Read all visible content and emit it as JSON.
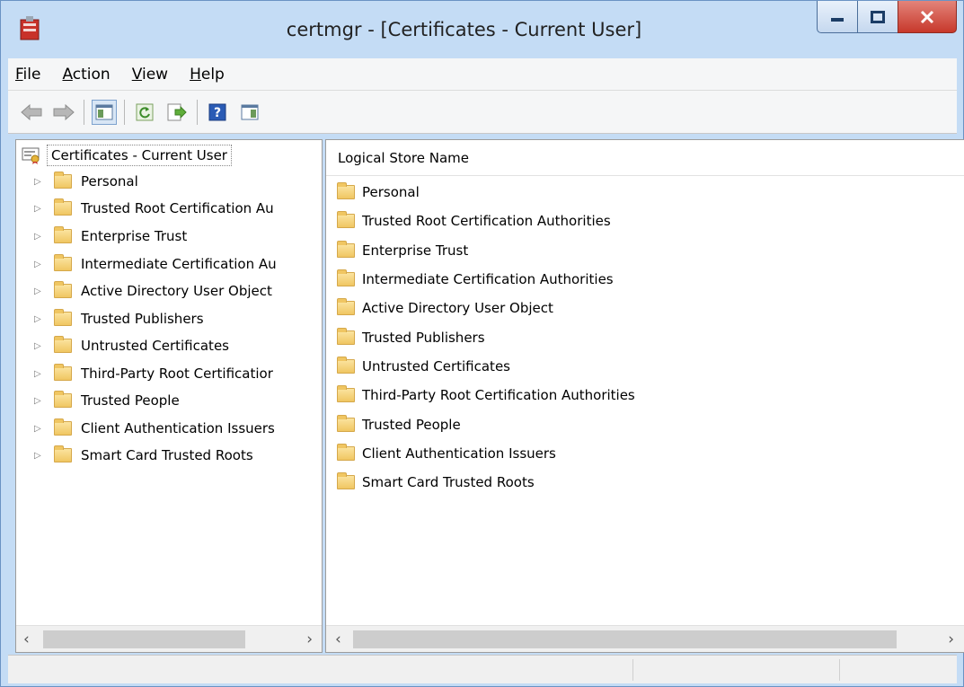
{
  "window": {
    "title": "certmgr - [Certificates - Current User]"
  },
  "menu": [
    {
      "label": "File",
      "accel": "F",
      "rest": "ile"
    },
    {
      "label": "Action",
      "accel": "A",
      "rest": "ction"
    },
    {
      "label": "View",
      "accel": "V",
      "rest": "iew"
    },
    {
      "label": "Help",
      "accel": "H",
      "rest": "elp"
    }
  ],
  "tree": {
    "root": "Certificates - Current User",
    "items": [
      "Personal",
      "Trusted Root Certification Au",
      "Enterprise Trust",
      "Intermediate Certification Au",
      "Active Directory User Object",
      "Trusted Publishers",
      "Untrusted Certificates",
      "Third-Party Root Certificatior",
      "Trusted People",
      "Client Authentication Issuers",
      "Smart Card Trusted Roots"
    ]
  },
  "list": {
    "column_header": "Logical Store Name",
    "items": [
      "Personal",
      "Trusted Root Certification Authorities",
      "Enterprise Trust",
      "Intermediate Certification Authorities",
      "Active Directory User Object",
      "Trusted Publishers",
      "Untrusted Certificates",
      "Third-Party Root Certification Authorities",
      "Trusted People",
      "Client Authentication Issuers",
      "Smart Card Trusted Roots"
    ]
  },
  "scroll": {
    "left": "‹",
    "right": "›"
  },
  "colors": {
    "frame": "#c4dcf5",
    "close_button": "#c7382b",
    "folder": "#f0c662"
  }
}
